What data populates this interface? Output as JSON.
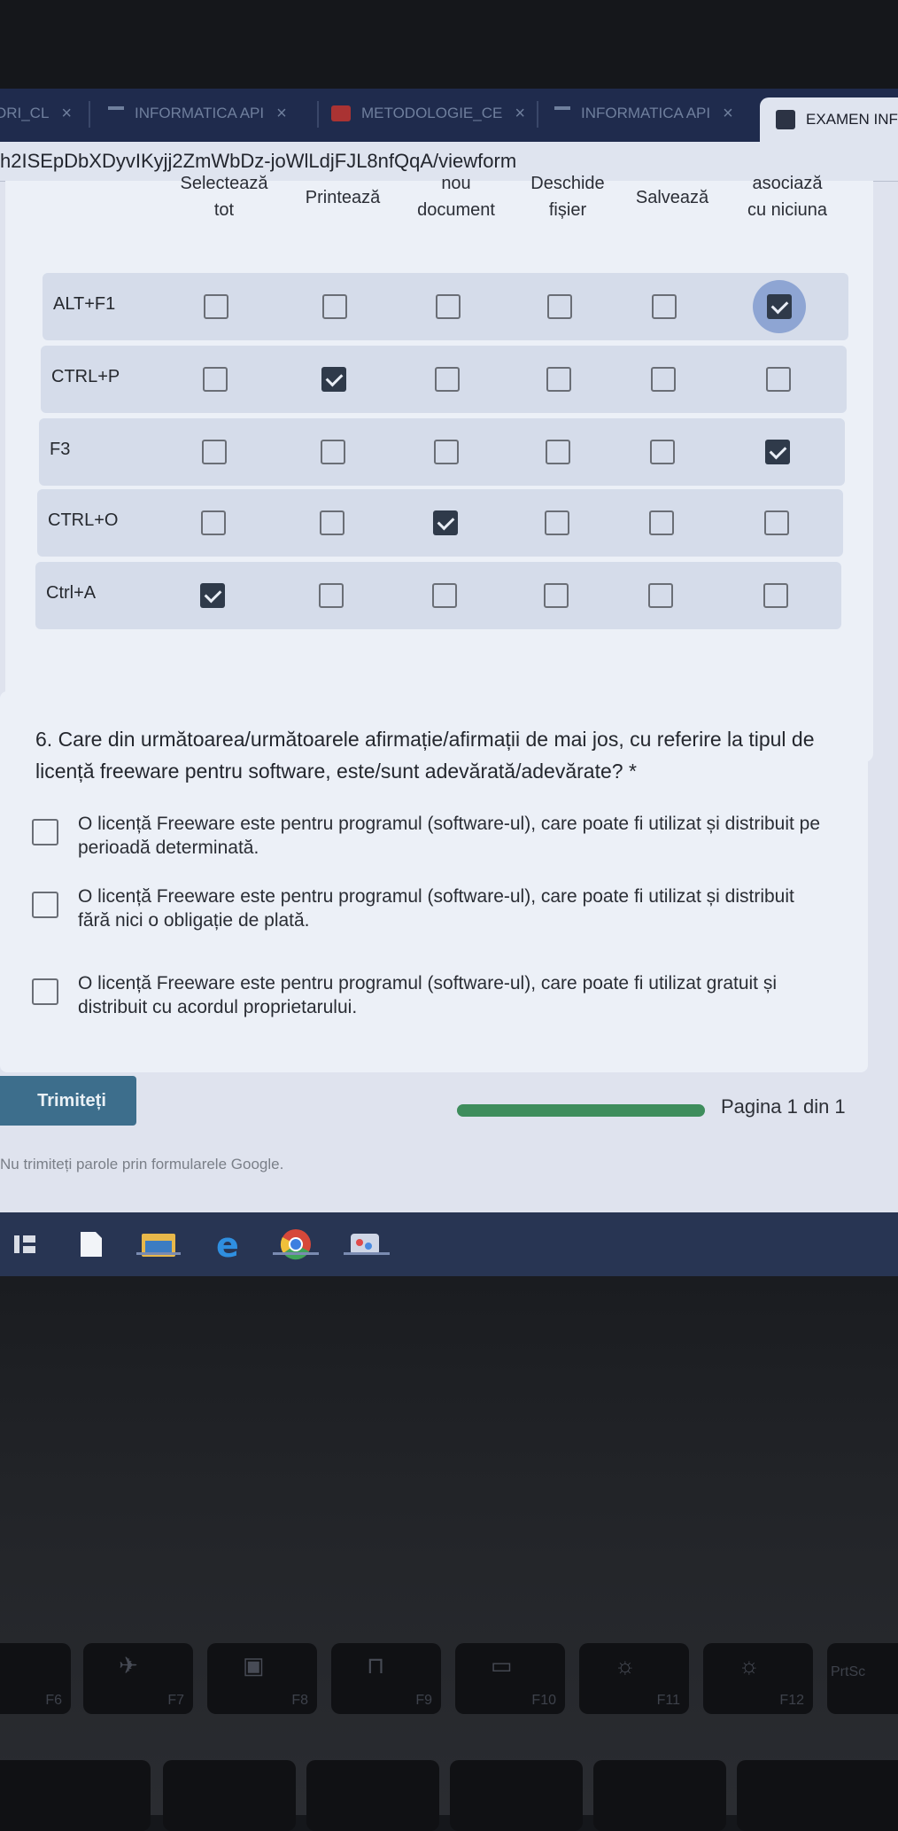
{
  "browser": {
    "tabs": [
      {
        "label": "ORI_CL",
        "active": false
      },
      {
        "label": "INFORMATICA API",
        "active": false
      },
      {
        "label": "METODOLOGIE_CE",
        "active": false
      },
      {
        "label": "INFORMATICA API",
        "active": false
      },
      {
        "label": "EXAMEN INF",
        "active": true
      }
    ],
    "tab_close_glyph": "×",
    "url": "h2ISEpDbXDyvIKyjj2ZmWbDz-joWlLdjFJL8nfQqA/viewform"
  },
  "grid": {
    "columns": [
      {
        "line1": "Selectează",
        "line2": "tot"
      },
      {
        "line1": "Printează",
        "line2": ""
      },
      {
        "line1": "nou",
        "line2": "document"
      },
      {
        "line1": "Deschide",
        "line2": "fișier"
      },
      {
        "line1": "Salvează",
        "line2": ""
      },
      {
        "line1": "asociază",
        "line2": "cu niciuna"
      }
    ],
    "rows": [
      {
        "label": "ALT+F1",
        "checked_column": 5
      },
      {
        "label": "CTRL+P",
        "checked_column": 1
      },
      {
        "label": "F3",
        "checked_column": 5
      },
      {
        "label": "CTRL+O",
        "checked_column": 2
      },
      {
        "label": "Ctrl+A",
        "checked_column": 0
      }
    ]
  },
  "question": {
    "text": "6. Care din următoarea/următoarele afirmație/afirmații de mai jos, cu referire la tipul de licență freeware pentru software, este/sunt adevărată/adevărate? *",
    "options": [
      {
        "text": "O licență Freeware este pentru programul (software-ul), care poate fi utilizat și distribuit pe perioadă determinată.",
        "checked": false
      },
      {
        "text": "O licență Freeware este pentru programul (software-ul), care poate fi utilizat și distribuit fără nici o obligație de plată.",
        "checked": false
      },
      {
        "text": "O licență Freeware este pentru programul (software-ul), care poate fi utilizat gratuit și distribuit cu acordul proprietarului.",
        "checked": false
      }
    ]
  },
  "footer": {
    "submit_label": "Trimiteți",
    "progress_fraction": 1.0,
    "page_label": "Pagina 1 din 1",
    "disclaimer": "Nu trimiteți parole prin formularele Google."
  },
  "taskbar": {
    "icons": [
      "task-view-icon",
      "notepad-icon",
      "file-explorer-icon",
      "edge-icon",
      "chrome-icon",
      "paint-icon"
    ]
  },
  "keyboard": {
    "fn_keys": [
      "F6",
      "F7",
      "F8",
      "F9",
      "F10",
      "F11",
      "F12",
      "PrtSc"
    ]
  },
  "colors": {
    "accent": "#3d6e8c",
    "progress": "#3e8d5c",
    "checkbox_checked": "#2f3a4a",
    "tabbar": "#1f2b4d",
    "taskbar": "#283553"
  }
}
